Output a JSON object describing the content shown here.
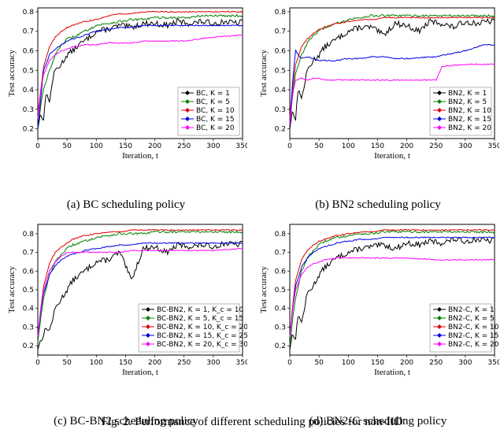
{
  "chart_data": [
    {
      "id": "a",
      "type": "line",
      "title": "",
      "xlabel": "Iteration, t",
      "ylabel": "Test accuracy",
      "xlim": [
        0,
        350
      ],
      "ylim": [
        0.15,
        0.82
      ],
      "xticks": [
        0,
        50,
        100,
        150,
        200,
        250,
        300,
        350
      ],
      "yticks": [
        0.2,
        0.3,
        0.4,
        0.5,
        0.6,
        0.7,
        0.8
      ],
      "series": [
        {
          "name": "BC, K = 1",
          "color": "#000000",
          "x": [
            0,
            5,
            10,
            15,
            20,
            25,
            30,
            40,
            50,
            60,
            70,
            80,
            100,
            120,
            140,
            160,
            180,
            200,
            220,
            240,
            260,
            280,
            300,
            320,
            340,
            350
          ],
          "y": [
            0.2,
            0.28,
            0.25,
            0.4,
            0.33,
            0.45,
            0.5,
            0.53,
            0.58,
            0.6,
            0.63,
            0.65,
            0.7,
            0.71,
            0.73,
            0.72,
            0.74,
            0.74,
            0.73,
            0.75,
            0.74,
            0.75,
            0.74,
            0.75,
            0.74,
            0.75
          ]
        },
        {
          "name": "BC, K = 5",
          "color": "#008000",
          "x": [
            0,
            5,
            10,
            15,
            20,
            30,
            40,
            50,
            60,
            80,
            100,
            120,
            140,
            160,
            180,
            200,
            220,
            240,
            260,
            280,
            300,
            320,
            340,
            350
          ],
          "y": [
            0.2,
            0.32,
            0.4,
            0.45,
            0.5,
            0.58,
            0.63,
            0.66,
            0.67,
            0.7,
            0.73,
            0.74,
            0.75,
            0.76,
            0.76,
            0.77,
            0.77,
            0.77,
            0.77,
            0.78,
            0.78,
            0.78,
            0.78,
            0.78
          ]
        },
        {
          "name": "BC, K = 10",
          "color": "#e00000",
          "x": [
            0,
            5,
            10,
            20,
            30,
            40,
            50,
            60,
            80,
            100,
            120,
            140,
            160,
            180,
            200,
            250,
            300,
            350
          ],
          "y": [
            0.28,
            0.4,
            0.52,
            0.62,
            0.67,
            0.7,
            0.72,
            0.73,
            0.75,
            0.76,
            0.78,
            0.79,
            0.79,
            0.8,
            0.8,
            0.8,
            0.8,
            0.8
          ]
        },
        {
          "name": "BC, K = 15",
          "color": "#0000e0",
          "x": [
            0,
            5,
            10,
            20,
            30,
            40,
            50,
            60,
            80,
            100,
            120,
            140,
            160,
            180,
            200,
            250,
            300,
            350
          ],
          "y": [
            0.2,
            0.35,
            0.5,
            0.58,
            0.61,
            0.63,
            0.65,
            0.66,
            0.68,
            0.7,
            0.71,
            0.72,
            0.72,
            0.73,
            0.73,
            0.73,
            0.73,
            0.73
          ]
        },
        {
          "name": "BC, K = 20",
          "color": "#ff00ff",
          "x": [
            0,
            5,
            10,
            20,
            30,
            40,
            50,
            60,
            80,
            100,
            120,
            140,
            160,
            180,
            200,
            250,
            300,
            350
          ],
          "y": [
            0.25,
            0.4,
            0.48,
            0.55,
            0.58,
            0.6,
            0.61,
            0.62,
            0.63,
            0.63,
            0.64,
            0.64,
            0.64,
            0.65,
            0.65,
            0.65,
            0.67,
            0.68
          ]
        }
      ]
    },
    {
      "id": "b",
      "type": "line",
      "title": "",
      "xlabel": "Iteration, t",
      "ylabel": "Test accuracy",
      "xlim": [
        0,
        350
      ],
      "ylim": [
        0.15,
        0.82
      ],
      "xticks": [
        0,
        50,
        100,
        150,
        200,
        250,
        300,
        350
      ],
      "yticks": [
        0.2,
        0.3,
        0.4,
        0.5,
        0.6,
        0.7,
        0.8
      ],
      "series": [
        {
          "name": "BN2, K = 1",
          "color": "#000000",
          "x": [
            0,
            5,
            10,
            15,
            20,
            30,
            40,
            50,
            60,
            80,
            100,
            120,
            140,
            160,
            180,
            200,
            220,
            240,
            260,
            280,
            300,
            320,
            340,
            350
          ],
          "y": [
            0.2,
            0.3,
            0.25,
            0.42,
            0.35,
            0.5,
            0.55,
            0.58,
            0.62,
            0.66,
            0.7,
            0.72,
            0.72,
            0.68,
            0.74,
            0.73,
            0.7,
            0.75,
            0.74,
            0.72,
            0.75,
            0.74,
            0.75,
            0.75
          ]
        },
        {
          "name": "BN2, K = 5",
          "color": "#008000",
          "x": [
            0,
            5,
            10,
            20,
            30,
            40,
            50,
            60,
            80,
            100,
            120,
            140,
            160,
            180,
            200,
            250,
            300,
            350
          ],
          "y": [
            0.25,
            0.38,
            0.48,
            0.58,
            0.64,
            0.68,
            0.7,
            0.72,
            0.74,
            0.76,
            0.77,
            0.78,
            0.78,
            0.78,
            0.78,
            0.78,
            0.78,
            0.78
          ]
        },
        {
          "name": "BN2, K = 10",
          "color": "#e00000",
          "x": [
            0,
            5,
            10,
            20,
            30,
            40,
            50,
            60,
            80,
            100,
            120,
            140,
            160,
            180,
            200,
            250,
            300,
            350
          ],
          "y": [
            0.26,
            0.42,
            0.53,
            0.62,
            0.66,
            0.69,
            0.71,
            0.72,
            0.74,
            0.75,
            0.76,
            0.76,
            0.77,
            0.77,
            0.77,
            0.77,
            0.77,
            0.77
          ]
        },
        {
          "name": "BN2, K = 15",
          "color": "#0000e0",
          "x": [
            0,
            5,
            10,
            20,
            30,
            40,
            50,
            60,
            80,
            100,
            120,
            140,
            160,
            180,
            200,
            250,
            300,
            330,
            350
          ],
          "y": [
            0.22,
            0.45,
            0.6,
            0.56,
            0.57,
            0.56,
            0.55,
            0.55,
            0.55,
            0.56,
            0.56,
            0.57,
            0.57,
            0.56,
            0.56,
            0.57,
            0.6,
            0.63,
            0.63
          ]
        },
        {
          "name": "BN2, K = 20",
          "color": "#ff00ff",
          "x": [
            0,
            5,
            10,
            20,
            30,
            40,
            50,
            60,
            80,
            100,
            150,
            200,
            250,
            260,
            300,
            350
          ],
          "y": [
            0.22,
            0.38,
            0.45,
            0.46,
            0.45,
            0.46,
            0.46,
            0.45,
            0.45,
            0.45,
            0.45,
            0.45,
            0.45,
            0.52,
            0.53,
            0.53
          ]
        }
      ]
    },
    {
      "id": "c",
      "type": "line",
      "title": "",
      "xlabel": "Iteration, t",
      "ylabel": "Test accuracy",
      "xlim": [
        0,
        350
      ],
      "ylim": [
        0.15,
        0.85
      ],
      "xticks": [
        0,
        50,
        100,
        150,
        200,
        250,
        300,
        350
      ],
      "yticks": [
        0.2,
        0.3,
        0.4,
        0.5,
        0.6,
        0.7,
        0.8
      ],
      "series": [
        {
          "name": "BC-BN2, K = 1, K_c = 10",
          "color": "#000000",
          "x": [
            0,
            5,
            10,
            15,
            20,
            30,
            40,
            50,
            60,
            80,
            100,
            120,
            140,
            160,
            180,
            200,
            220,
            240,
            260,
            280,
            300,
            320,
            340,
            350
          ],
          "y": [
            0.18,
            0.23,
            0.26,
            0.3,
            0.28,
            0.4,
            0.45,
            0.5,
            0.55,
            0.6,
            0.65,
            0.66,
            0.7,
            0.55,
            0.72,
            0.73,
            0.7,
            0.74,
            0.73,
            0.74,
            0.73,
            0.75,
            0.74,
            0.75
          ]
        },
        {
          "name": "BC-BN2, K = 5, K_c = 15",
          "color": "#008000",
          "x": [
            0,
            5,
            10,
            20,
            30,
            40,
            50,
            60,
            80,
            100,
            120,
            140,
            160,
            180,
            200,
            250,
            300,
            350
          ],
          "y": [
            0.22,
            0.35,
            0.45,
            0.58,
            0.65,
            0.69,
            0.72,
            0.74,
            0.76,
            0.78,
            0.79,
            0.8,
            0.8,
            0.8,
            0.81,
            0.81,
            0.81,
            0.81
          ]
        },
        {
          "name": "BC-BN2, K = 10, K_c = 20",
          "color": "#e00000",
          "x": [
            0,
            5,
            10,
            20,
            30,
            40,
            50,
            60,
            80,
            100,
            120,
            140,
            160,
            180,
            200,
            250,
            300,
            350
          ],
          "y": [
            0.25,
            0.4,
            0.52,
            0.64,
            0.7,
            0.73,
            0.75,
            0.77,
            0.79,
            0.8,
            0.81,
            0.81,
            0.82,
            0.82,
            0.82,
            0.82,
            0.82,
            0.82
          ]
        },
        {
          "name": "BC-BN2, K = 15, K_c = 25",
          "color": "#0000e0",
          "x": [
            0,
            5,
            10,
            20,
            30,
            40,
            50,
            60,
            80,
            100,
            120,
            140,
            160,
            180,
            200,
            250,
            300,
            350
          ],
          "y": [
            0.25,
            0.38,
            0.48,
            0.58,
            0.63,
            0.66,
            0.68,
            0.69,
            0.71,
            0.72,
            0.73,
            0.74,
            0.74,
            0.75,
            0.75,
            0.75,
            0.75,
            0.75
          ]
        },
        {
          "name": "BC-BN2, K = 20, K_c = 30",
          "color": "#ff00ff",
          "x": [
            0,
            5,
            10,
            20,
            30,
            40,
            50,
            60,
            80,
            100,
            120,
            140,
            160,
            180,
            200,
            250,
            300,
            350
          ],
          "y": [
            0.25,
            0.4,
            0.5,
            0.6,
            0.65,
            0.68,
            0.7,
            0.7,
            0.7,
            0.7,
            0.7,
            0.7,
            0.71,
            0.71,
            0.71,
            0.71,
            0.71,
            0.72
          ]
        }
      ]
    },
    {
      "id": "d",
      "type": "line",
      "title": "",
      "xlabel": "Iteration, t",
      "ylabel": "Test accuracy",
      "xlim": [
        0,
        350
      ],
      "ylim": [
        0.15,
        0.85
      ],
      "xticks": [
        0,
        50,
        100,
        150,
        200,
        250,
        300,
        350
      ],
      "yticks": [
        0.2,
        0.3,
        0.4,
        0.5,
        0.6,
        0.7,
        0.8
      ],
      "series": [
        {
          "name": "BN2-C, K = 1",
          "color": "#000000",
          "x": [
            0,
            5,
            10,
            15,
            20,
            30,
            40,
            50,
            60,
            80,
            100,
            120,
            140,
            160,
            180,
            200,
            220,
            240,
            260,
            280,
            300,
            320,
            340,
            350
          ],
          "y": [
            0.18,
            0.27,
            0.24,
            0.38,
            0.32,
            0.48,
            0.52,
            0.58,
            0.62,
            0.67,
            0.7,
            0.72,
            0.73,
            0.74,
            0.72,
            0.75,
            0.74,
            0.76,
            0.75,
            0.77,
            0.76,
            0.77,
            0.76,
            0.77
          ]
        },
        {
          "name": "BN2-C, K = 5",
          "color": "#008000",
          "x": [
            0,
            5,
            10,
            20,
            30,
            40,
            50,
            60,
            80,
            100,
            120,
            140,
            160,
            180,
            200,
            250,
            300,
            350
          ],
          "y": [
            0.2,
            0.35,
            0.45,
            0.6,
            0.67,
            0.71,
            0.74,
            0.76,
            0.78,
            0.79,
            0.8,
            0.8,
            0.81,
            0.81,
            0.81,
            0.81,
            0.81,
            0.81
          ]
        },
        {
          "name": "BN2-C, K = 10",
          "color": "#e00000",
          "x": [
            0,
            5,
            10,
            20,
            30,
            40,
            50,
            60,
            80,
            100,
            120,
            140,
            160,
            180,
            200,
            250,
            300,
            350
          ],
          "y": [
            0.25,
            0.42,
            0.55,
            0.66,
            0.71,
            0.74,
            0.76,
            0.77,
            0.79,
            0.8,
            0.81,
            0.81,
            0.82,
            0.82,
            0.82,
            0.82,
            0.82,
            0.82
          ]
        },
        {
          "name": "BN2-C, K = 15",
          "color": "#0000e0",
          "x": [
            0,
            5,
            10,
            20,
            30,
            40,
            50,
            60,
            80,
            100,
            120,
            140,
            160,
            180,
            200,
            250,
            300,
            350
          ],
          "y": [
            0.25,
            0.4,
            0.52,
            0.62,
            0.67,
            0.7,
            0.72,
            0.73,
            0.75,
            0.76,
            0.77,
            0.77,
            0.78,
            0.78,
            0.78,
            0.78,
            0.78,
            0.78
          ]
        },
        {
          "name": "BN2-C, K = 20",
          "color": "#ff00ff",
          "x": [
            0,
            5,
            10,
            20,
            30,
            40,
            50,
            60,
            80,
            100,
            120,
            140,
            160,
            180,
            200,
            250,
            300,
            350
          ],
          "y": [
            0.25,
            0.4,
            0.5,
            0.58,
            0.62,
            0.64,
            0.65,
            0.66,
            0.67,
            0.67,
            0.67,
            0.67,
            0.67,
            0.67,
            0.67,
            0.66,
            0.66,
            0.66
          ]
        }
      ]
    }
  ],
  "captions": {
    "a": "(a) BC scheduling policy",
    "b": "(b) BN2 scheduling policy",
    "c": "(c) BC-BN2 scheduling policy",
    "d": "(d) BN2-C scheduling policy"
  },
  "legend_marker": "diamond",
  "footer": "Fig. 2. Performance of different scheduling policies for non-IID"
}
